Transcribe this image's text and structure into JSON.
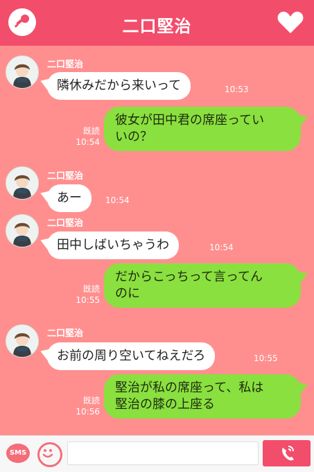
{
  "header": {
    "title": "二口堅治",
    "left_icon": "key-icon",
    "right_icon": "heart-icon"
  },
  "messages": [
    {
      "type": "in",
      "sender": "二口堅治",
      "text": "隣休みだから来いって",
      "time": "10:53"
    },
    {
      "type": "out",
      "read": "既読",
      "time": "10:54",
      "lines": [
        "彼女が田中君の席座ってい",
        "いの？"
      ]
    },
    {
      "type": "in",
      "sender": "二口堅治",
      "text": "あー",
      "time": "10:54"
    },
    {
      "type": "in",
      "sender": "二口堅治",
      "text": "田中しばいちゃうわ",
      "time": "10:54"
    },
    {
      "type": "out",
      "read": "既読",
      "time": "10:55",
      "lines": [
        "だからこっちって言ってん",
        "のに"
      ]
    },
    {
      "type": "in",
      "sender": "二口堅治",
      "text": "お前の周り空いてねえだろ",
      "time": "10:55"
    },
    {
      "type": "out",
      "read": "既読",
      "time": "10:56",
      "lines": [
        "堅治が私の席座って、私は",
        "堅治の膝の上座る"
      ]
    }
  ],
  "footer": {
    "sms_label": "SMS",
    "input_value": "",
    "icons": [
      "sms-icon",
      "smile-icon",
      "phone-icon"
    ]
  },
  "colors": {
    "header": "#f24d6b",
    "background": "#ff8f8f",
    "outgoing_bubble": "#8ae03f",
    "incoming_bubble": "#ffffff"
  }
}
